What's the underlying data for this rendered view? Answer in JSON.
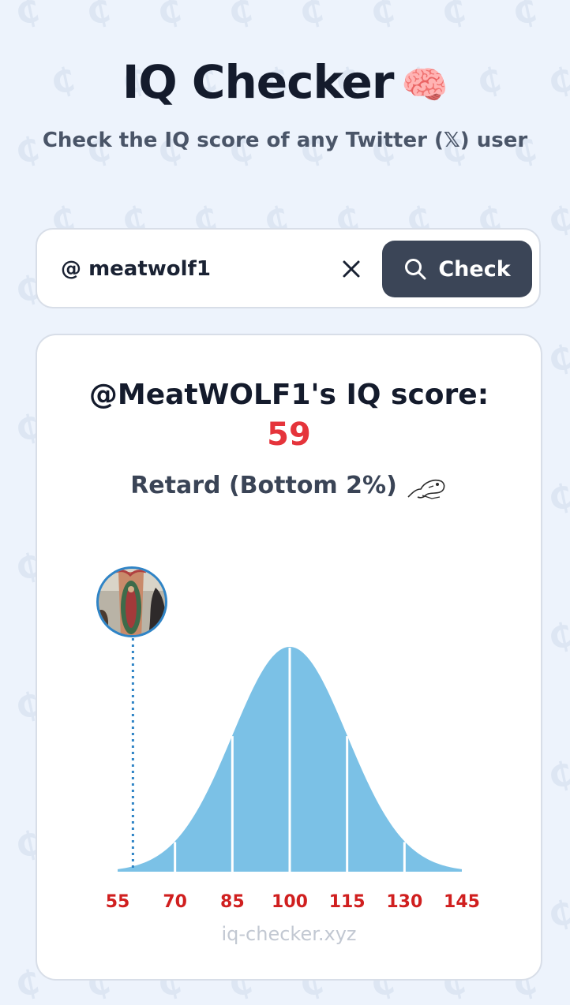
{
  "header": {
    "title": "IQ Checker",
    "title_emoji": "🧠",
    "subtitle": "Check the IQ score of any Twitter (𝕏) user"
  },
  "search": {
    "prefix": "@",
    "value": "meatwolf1",
    "clear_icon": "close-icon",
    "check_label": "Check",
    "check_icon": "search-icon"
  },
  "result": {
    "heading": "@MeatWOLF1's IQ score:",
    "score": "59",
    "category": "Retard (Bottom 2%)",
    "category_icon": "meme-face-icon",
    "marker_value": 59,
    "avatar": "user-avatar"
  },
  "chart_data": {
    "type": "area",
    "distribution": "normal",
    "mean": 100,
    "sd": 15,
    "x_ticks": [
      55,
      70,
      85,
      100,
      115,
      130,
      145
    ],
    "xlim": [
      55,
      145
    ],
    "dividers": [
      70,
      85,
      100,
      115,
      130
    ],
    "marker": 59,
    "fill_color": "#7bc1e6",
    "tick_color": "#d01f1f",
    "marker_color": "#2f84c6"
  },
  "footer": {
    "site": "iq-checker.xyz"
  }
}
